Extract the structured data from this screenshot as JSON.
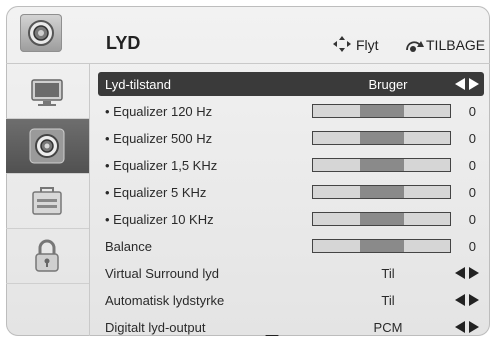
{
  "header": {
    "title": "LYD",
    "move_label": "Flyt",
    "back_label": "TILBAGE"
  },
  "sidebar": {
    "tabs": [
      {
        "name": "picture-tab",
        "icon": "tv-icon",
        "active": false
      },
      {
        "name": "sound-tab",
        "icon": "speaker-icon",
        "active": true
      },
      {
        "name": "setup-tab",
        "icon": "toolbox-icon",
        "active": false
      },
      {
        "name": "lock-tab",
        "icon": "lock-icon",
        "active": false
      }
    ]
  },
  "menu": {
    "rows": [
      {
        "label": "Lyd-tilstand",
        "kind": "option",
        "value": "Bruger",
        "active": true
      },
      {
        "label": "• Equalizer 120 Hz",
        "kind": "slider",
        "value": "0",
        "level": 0.5
      },
      {
        "label": "• Equalizer 500 Hz",
        "kind": "slider",
        "value": "0",
        "level": 0.5
      },
      {
        "label": "• Equalizer 1,5 KHz",
        "kind": "slider",
        "value": "0",
        "level": 0.5
      },
      {
        "label": "• Equalizer 5 KHz",
        "kind": "slider",
        "value": "0",
        "level": 0.5
      },
      {
        "label": "• Equalizer 10 KHz",
        "kind": "slider",
        "value": "0",
        "level": 0.5
      },
      {
        "label": "Balance",
        "kind": "slider",
        "value": "0",
        "level": 0.5
      },
      {
        "label": "Virtual Surround lyd",
        "kind": "option",
        "value": "Til"
      },
      {
        "label": "Automatisk lydstyrke",
        "kind": "option",
        "value": "Til"
      },
      {
        "label": "Digitalt lyd-output",
        "kind": "option",
        "value": "PCM"
      }
    ]
  },
  "colors": {
    "active_row": "#3a3a3a",
    "active_tab": "#5f5f5f",
    "slider_fill": "#8a8a8a"
  }
}
